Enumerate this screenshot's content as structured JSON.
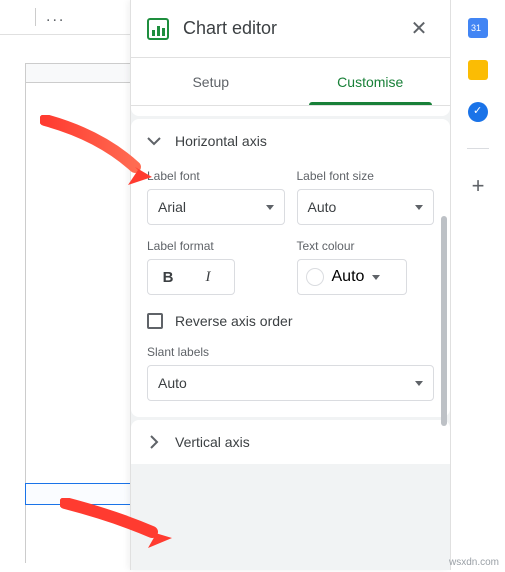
{
  "toolbar": {
    "more": "..."
  },
  "panel": {
    "title": "Chart editor"
  },
  "tabs": {
    "setup": "Setup",
    "customise": "Customise"
  },
  "hAxis": {
    "title": "Horizontal axis",
    "labelFont": {
      "label": "Label font",
      "value": "Arial"
    },
    "labelFontSize": {
      "label": "Label font size",
      "value": "Auto"
    },
    "labelFormat": {
      "label": "Label format"
    },
    "textColour": {
      "label": "Text colour",
      "value": "Auto"
    },
    "reverse": "Reverse axis order",
    "slant": {
      "label": "Slant labels",
      "value": "Auto"
    }
  },
  "vAxis": {
    "title": "Vertical axis"
  },
  "watermark": "wsxdn.com"
}
